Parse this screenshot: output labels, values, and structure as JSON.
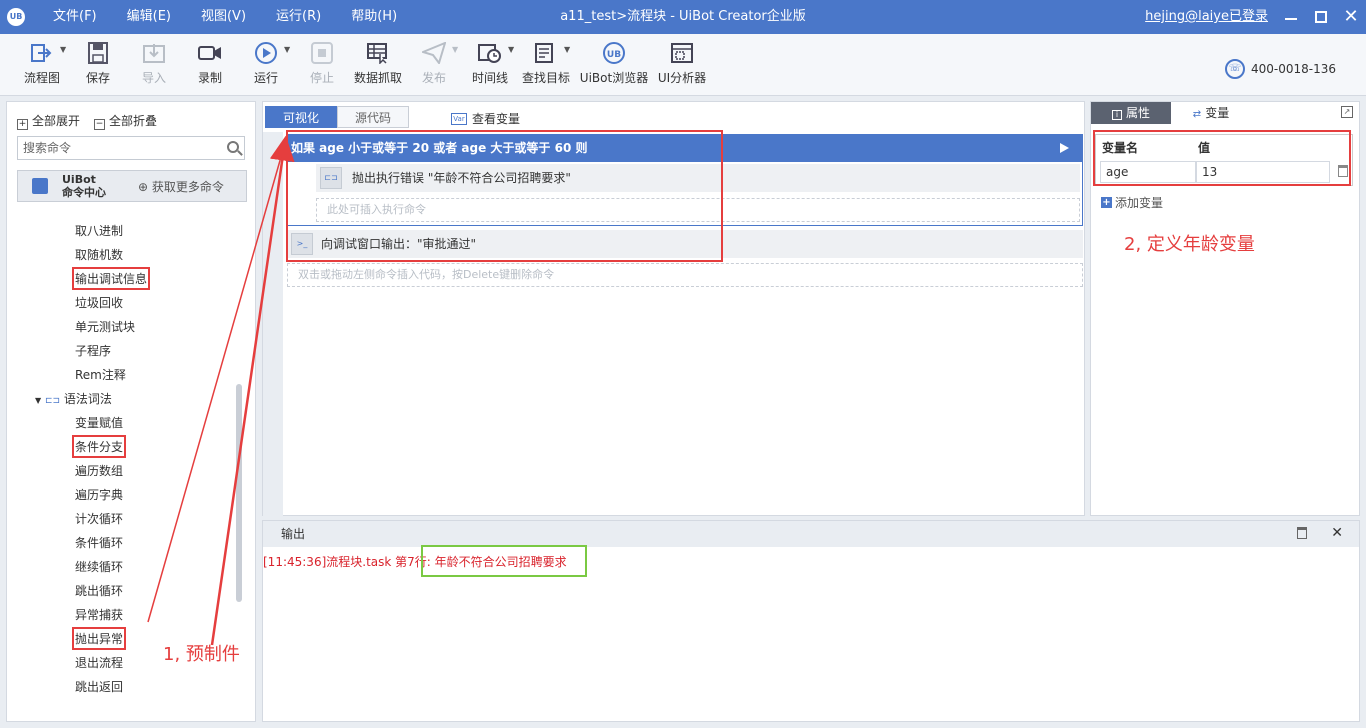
{
  "window": {
    "logo": "UB",
    "title": "a11_test>流程块 - UiBot Creator企业版",
    "login": "hejing@laiye已登录"
  },
  "menu": [
    "文件(F)",
    "编辑(E)",
    "视图(V)",
    "运行(R)",
    "帮助(H)"
  ],
  "toolbar": {
    "flowchart": "流程图",
    "save": "保存",
    "import": "导入",
    "record": "录制",
    "run": "运行",
    "stop": "停止",
    "data_capture": "数据抓取",
    "publish": "发布",
    "timeline": "时间线",
    "find_target": "查找目标",
    "browser": "UiBot浏览器",
    "ui_analyzer": "UI分析器",
    "phone": "400-0018-136"
  },
  "left_panel": {
    "expand_all": "全部展开",
    "collapse_all": "全部折叠",
    "search_placeholder": "搜索命令",
    "cmd_center_line1": "UiBot",
    "cmd_center_line2": "命令中心",
    "get_more": "获取更多命令",
    "items": [
      "取八进制",
      "取随机数",
      "输出调试信息",
      "垃圾回收",
      "单元测试块",
      "子程序",
      "Rem注释"
    ],
    "group": "语法词法",
    "group_items": [
      "变量赋值",
      "条件分支",
      "遍历数组",
      "遍历字典",
      "计次循环",
      "条件循环",
      "继续循环",
      "跳出循环",
      "异常捕获",
      "抛出异常",
      "退出流程",
      "跳出返回"
    ]
  },
  "editor": {
    "tab_visual": "可视化",
    "tab_source": "源代码",
    "view_vars": "查看变量",
    "if_text": "如果 age 小于或等于 20 或者 age 大于或等于 60 则",
    "throw_text": "抛出执行错误 \"年龄不符合公司招聘要求\"",
    "insert_here": "此处可插入执行命令",
    "trace_text": "向调试窗口输出：\"审批通过\"",
    "hint": "双击或拖动左侧命令插入代码，按Delete键删除命令"
  },
  "right_panel": {
    "tab_props": "属性",
    "tab_vars": "变量",
    "col_name": "变量名",
    "col_value": "值",
    "var_name": "age",
    "var_value": "13",
    "add_var": "添加变量"
  },
  "output": {
    "tab": "输出",
    "line_prefix": "[11:45:36]流程块.task 第7行:",
    "line_msg": "年龄不符合公司招聘要求"
  },
  "annotations": {
    "step1": "1, 预制件",
    "step2": "2, 定义年龄变量"
  },
  "colors": {
    "accent": "#4a77c9",
    "annotation_red": "#e53e3e",
    "annotation_green": "#7ac943",
    "error_text": "#d9232c"
  }
}
